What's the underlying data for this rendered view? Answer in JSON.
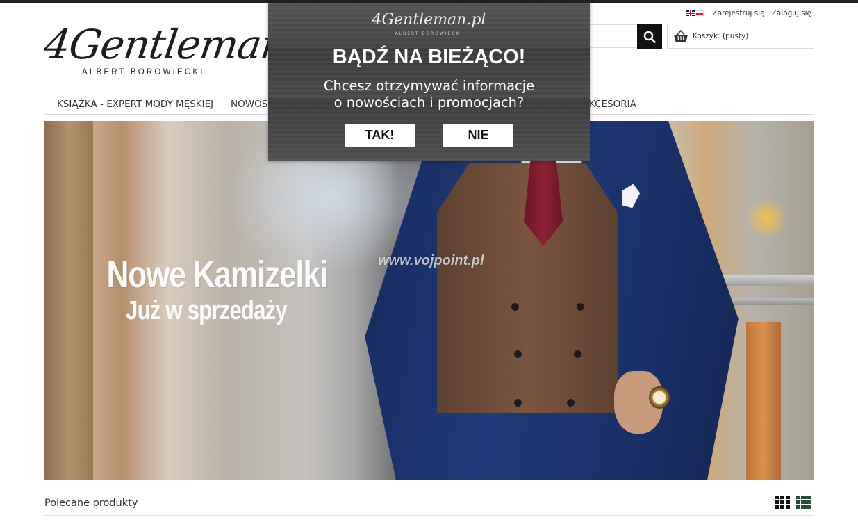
{
  "header": {
    "register_label": "Zarejestruj się",
    "login_label": "Zaloguj się",
    "logo_main": "4Gentleman.pl",
    "logo_sub": "ALBERT BOROWIECKI",
    "cart_label": "Koszyk: (pusty)",
    "search_placeholder": "",
    "languages": [
      "en-flag-icon",
      "pl-flag-icon"
    ]
  },
  "nav": {
    "items": [
      {
        "label": "KSIĄŻKA - EXPERT MODY MĘSKIEJ"
      },
      {
        "label": "NOWOŚ"
      },
      {
        "label": "KCESORIA"
      }
    ]
  },
  "banner": {
    "title": "Nowe Kamizelki",
    "subtitle": "Już w sprzedaży",
    "watermark": "www.vojpoint.pl"
  },
  "featured": {
    "title": "Polecane produkty",
    "views": [
      "grid-view-icon",
      "list-view-icon"
    ]
  },
  "popup": {
    "logo": "4Gentleman.pl",
    "logo_sub": "ALBERT BOROWIECKI",
    "title": "BĄDŹ NA BIEŻĄCO!",
    "text_line1": "Chcesz otrzymywać informacje",
    "text_line2": "o nowościach i promocjach?",
    "yes_label": "TAK!",
    "no_label": "NIE"
  },
  "colors": {
    "topbar": "#222222",
    "search_button": "#111111",
    "popup_bg": "#4a4a4a"
  }
}
